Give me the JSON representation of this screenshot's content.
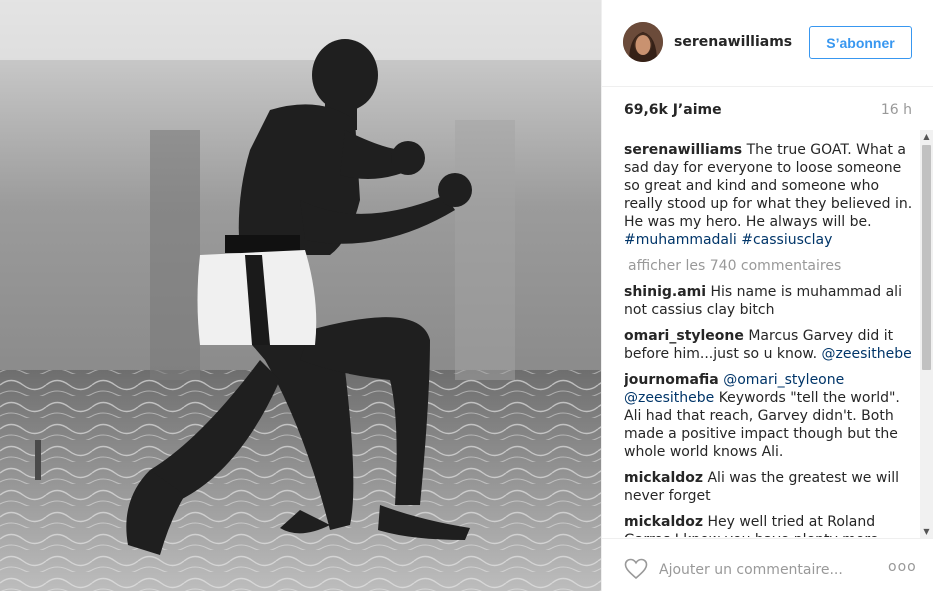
{
  "post": {
    "username": "serenawilliams",
    "follow_label": "S’abonner",
    "likes": "69,6k J’aime",
    "time": "16 h",
    "caption": {
      "username": "serenawilliams",
      "text": "The true GOAT. What a sad day for everyone to loose someone so great and kind and someone who really stood up for what they believed in. He was my hero. He always will be.",
      "hashtag1": "#muhammadali",
      "hashtag2": "#cassiusclay"
    },
    "show_more": "afficher les 740 commentaires",
    "comments": [
      {
        "user": "shinig.ami",
        "text": "His name is muhammad ali not cassius clay bitch"
      },
      {
        "user": "omari_styleone",
        "text": "Marcus Garvey did it before him...just so u know.",
        "mention": "@zeesithebe"
      },
      {
        "user": "journomafia",
        "mention1": "@omari_styleone",
        "mention2": "@zeesithebe",
        "text": "Keywords \"tell the world\". Ali had that reach, Garvey didn't. Both made a positive impact though but the whole world knows Ali."
      },
      {
        "user": "mickaldoz",
        "text": "Ali was the greatest we will never forget"
      },
      {
        "user": "mickaldoz",
        "text": "Hey well tried at Roland Garros I know you have plenty more"
      }
    ],
    "add_comment_placeholder": "Ajouter un commentaire...",
    "more_label": "ooo"
  },
  "colors": {
    "link": "#003569",
    "follow": "#3897f0",
    "muted": "#999999"
  },
  "icons": {
    "like": "heart-icon",
    "scroll_up": "chevron-up-icon",
    "scroll_down": "chevron-down-icon"
  }
}
